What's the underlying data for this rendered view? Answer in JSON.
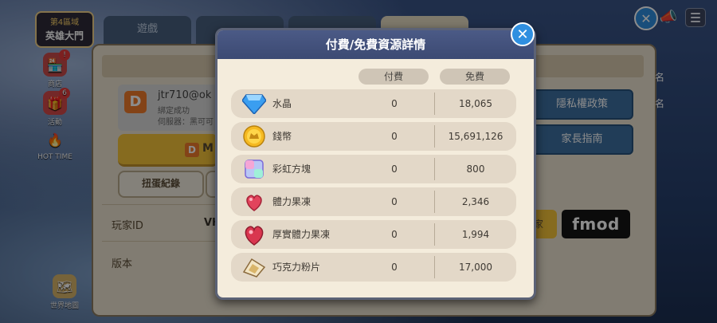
{
  "hud": {
    "zone_num": "第4區域",
    "zone_name": "英雄大門",
    "shop_label": "商店",
    "shop_badge": "!",
    "event_label": "活動",
    "event_badge": "6",
    "hottime_label": "HOT TIME",
    "worldmap_label": "世界地圖"
  },
  "settings": {
    "tabs": [
      "遊戲",
      "",
      "",
      ""
    ],
    "account_initial": "D",
    "account_name": "jtr710@ok",
    "account_status": "綁定成功",
    "account_server": "伺服器：黑可可",
    "connect_btn_text": "M",
    "gacha_btn": "扭蛋紀錄",
    "player_id_label": "玩家ID",
    "player_id_value": "VH",
    "version_label": "版本",
    "privacy_btn": "隱私權政策",
    "parent_btn": "家長指南",
    "yellow_strip_text": "家",
    "fmod_text": "fmod",
    "right_label_1": "名",
    "right_label_2": "名"
  },
  "modal": {
    "title": "付費/免費資源詳情",
    "close_symbol": "✕",
    "col_paid": "付費",
    "col_free": "免費",
    "rows": [
      {
        "name": "水晶",
        "paid": "0",
        "free": "18,065",
        "icon": "crystal-icon"
      },
      {
        "name": "錢幣",
        "paid": "0",
        "free": "15,691,126",
        "icon": "coin-icon"
      },
      {
        "name": "彩虹方塊",
        "paid": "0",
        "free": "800",
        "icon": "rainbow-cube-icon"
      },
      {
        "name": "體力果凍",
        "paid": "0",
        "free": "2,346",
        "icon": "stamina-jelly-icon"
      },
      {
        "name": "厚實體力果凍",
        "paid": "0",
        "free": "1,994",
        "icon": "thick-stamina-jelly-icon"
      },
      {
        "name": "巧克力粉片",
        "paid": "0",
        "free": "17,000",
        "icon": "chocolate-shard-icon"
      }
    ]
  },
  "colors": {
    "modal_header": "#3c4a73",
    "close_button": "#2f8fe0",
    "accent_yellow": "#f5c43a"
  }
}
